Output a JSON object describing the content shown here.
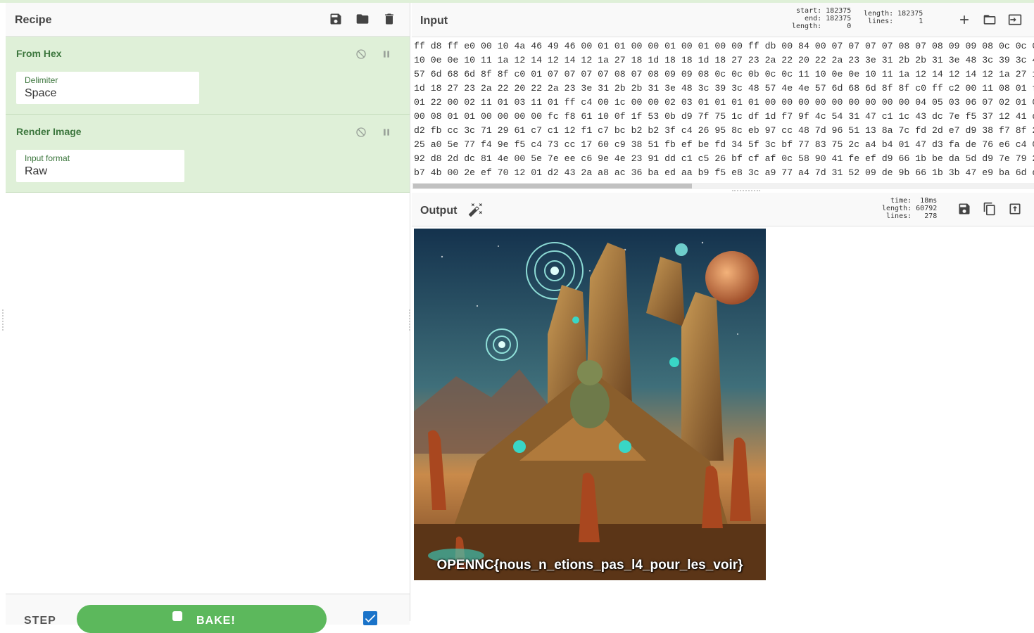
{
  "recipe": {
    "title": "Recipe",
    "operations": [
      {
        "name": "From Hex",
        "field_label": "Delimiter",
        "field_value": "Space"
      },
      {
        "name": "Render Image",
        "field_label": "Input format",
        "field_value": "Raw"
      }
    ],
    "step_label": "STEP",
    "bake_label": "BAKE!",
    "auto_bake_checked": true
  },
  "input": {
    "title": "Input",
    "stats_left": "start: 182375\n  end: 182375\nlength:      0",
    "stats_right": "length: 182375\n lines:      1",
    "hex_lines": [
      "ff d8 ff e0 00 10 4a 46 49 46 00 01 01 00 00 01 00 01 00 00 ff db 00 84 00 07 07 07 07 08 07 08 09 09 08 0c 0c 0b 0",
      "10 0e 0e 10 11 1a 12 14 12 14 12 1a 27 18 1d 18 18 1d 18 27 23 2a 22 20 22 2a 23 3e 31 2b 2b 31 3e 48 3c 39 3c 48 5",
      "57 6d 68 6d 8f 8f c0 01 07 07 07 07 08 07 08 09 09 08 0c 0c 0b 0c 0c 11 10 0e 0e 10 11 1a 12 14 12 14 12 1a 27 18 1",
      "1d 18 27 23 2a 22 20 22 2a 23 3e 31 2b 2b 31 3e 48 3c 39 3c 48 57 4e 4e 57 6d 68 6d 8f 8f c0 ff c2 00 11 08 01 f4 0",
      "01 22 00 02 11 01 03 11 01 ff c4 00 1c 00 00 02 03 01 01 01 01 00 00 00 00 00 00 00 00 00 04 05 03 06 07 02 01 00 0",
      "00 08 01 01 00 00 00 00 fc f8 61 10 0f 1f 53 0b d9 7f 75 1c df 1d f7 9f 4c 54 31 47 c1 1c 43 dc 7e f5 37 12 41 df b",
      "d2 fb cc 3c 71 29 61 c7 c1 12 f1 c7 bc b2 b2 3f c4 26 95 8c eb 97 cc 48 7d 96 51 13 8a 7c fd 2d e7 d9 38 f7 8f 25 8",
      "25 a0 5e 77 f4 9e f5 c4 73 cc 17 60 c9 38 51 fb ef be fd 34 5f 3c bf 77 83 75 2c a4 b4 01 47 d3 fa de 76 e6 c4 0c a",
      "92 d8 2d dc 81 4e 00 5e 7e ee c6 9e 4e 23 91 dd c1 c5 26 bf cf af 0c 58 90 41 fe ef d9 66 1b be da 5d d9 7e 79 23 0",
      "b7 4b 00 2e ef 70 12 01 d2 43 2a a8 ac 36 ba ed aa b9 f5 e8 3c a9 77 a4 7d 31 52 09 de 9b 66 1b 3b 47 e9 ba 6d d7 2"
    ]
  },
  "output": {
    "title": "Output",
    "stats": "  time:  18ms\nlength: 60792\n lines:   278",
    "image_caption": "OPENNC{nous_n_etions_pas_l4_pour_les_voir}"
  },
  "icons": {
    "recipe_head": [
      "save-icon",
      "folder-icon",
      "trash-icon"
    ],
    "operation": [
      "disable-icon",
      "pause-icon"
    ],
    "input_head": [
      "plus-icon",
      "folder-icon",
      "switch-icon"
    ],
    "output_head": [
      "save-icon",
      "copy-icon",
      "replace-input-icon"
    ],
    "magic": "magic-wand-icon"
  },
  "colors": {
    "operation_bg": "#dff0d8",
    "operation_title": "#3c763d",
    "bake_button": "#5cb85c",
    "checkbox": "#1a73c9"
  }
}
